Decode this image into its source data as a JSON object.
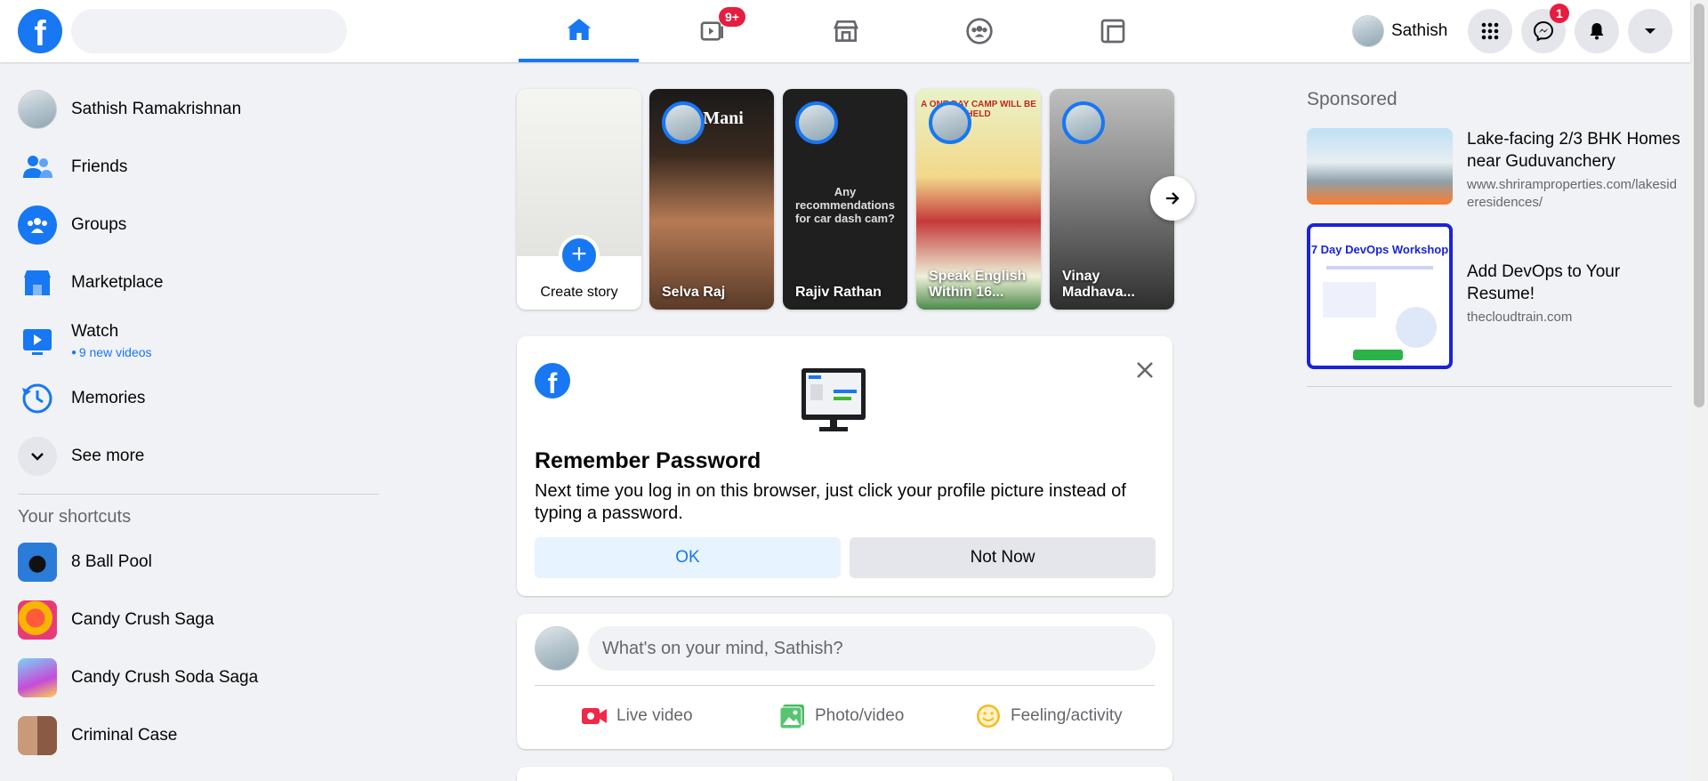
{
  "header": {
    "search_placeholder": "",
    "watch_badge": "9+",
    "profile_name": "Sathish",
    "messenger_badge": "1"
  },
  "sidebar": {
    "items": [
      {
        "label": "Sathish Ramakrishnan",
        "icon": "avatar"
      },
      {
        "label": "Friends",
        "icon": "friends-icon"
      },
      {
        "label": "Groups",
        "icon": "groups-icon"
      },
      {
        "label": "Marketplace",
        "icon": "marketplace-icon"
      },
      {
        "label": "Watch",
        "icon": "watch-icon",
        "sub": "9 new videos"
      },
      {
        "label": "Memories",
        "icon": "memories-icon"
      },
      {
        "label": "See more",
        "icon": "chevron-down-icon"
      }
    ],
    "shortcuts_heading": "Your shortcuts",
    "shortcuts": [
      {
        "label": "8 Ball Pool"
      },
      {
        "label": "Candy Crush Saga"
      },
      {
        "label": "Candy Crush Soda Saga"
      },
      {
        "label": "Criminal Case"
      }
    ]
  },
  "stories": {
    "create_label": "Create story",
    "items": [
      {
        "name": "Selva Raj",
        "overlay": "da Mani"
      },
      {
        "name": "Rajiv Rathan",
        "overlay": "Any recommendations for car dash cam?"
      },
      {
        "name": "Speak English Within 16...",
        "overlay": "A ONE DAY CAMP WILL BE HELD"
      },
      {
        "name": "Vinay Madhava...",
        "overlay": ""
      }
    ]
  },
  "remember_password": {
    "title": "Remember Password",
    "body": "Next time you log in on this browser, just click your profile picture instead of typing a password.",
    "ok_label": "OK",
    "not_now_label": "Not Now"
  },
  "composer": {
    "placeholder": "What's on your mind, Sathish?",
    "actions": [
      {
        "label": "Live video",
        "color": "#f02849"
      },
      {
        "label": "Photo/video",
        "color": "#45bd62"
      },
      {
        "label": "Feeling/activity",
        "color": "#f7b928"
      }
    ]
  },
  "sponsored": {
    "heading": "Sponsored",
    "ads": [
      {
        "title": "Lake-facing 2/3 BHK Homes near Guduvanchery",
        "url": "www.shriramproperties.com/lakesideresidences/"
      },
      {
        "title": "Add DevOps to Your Resume!",
        "url": "thecloudtrain.com",
        "image_text": "7 Day DevOps Workshop"
      }
    ]
  },
  "colors": {
    "brand": "#1877f2",
    "badge": "#e41e3f"
  }
}
